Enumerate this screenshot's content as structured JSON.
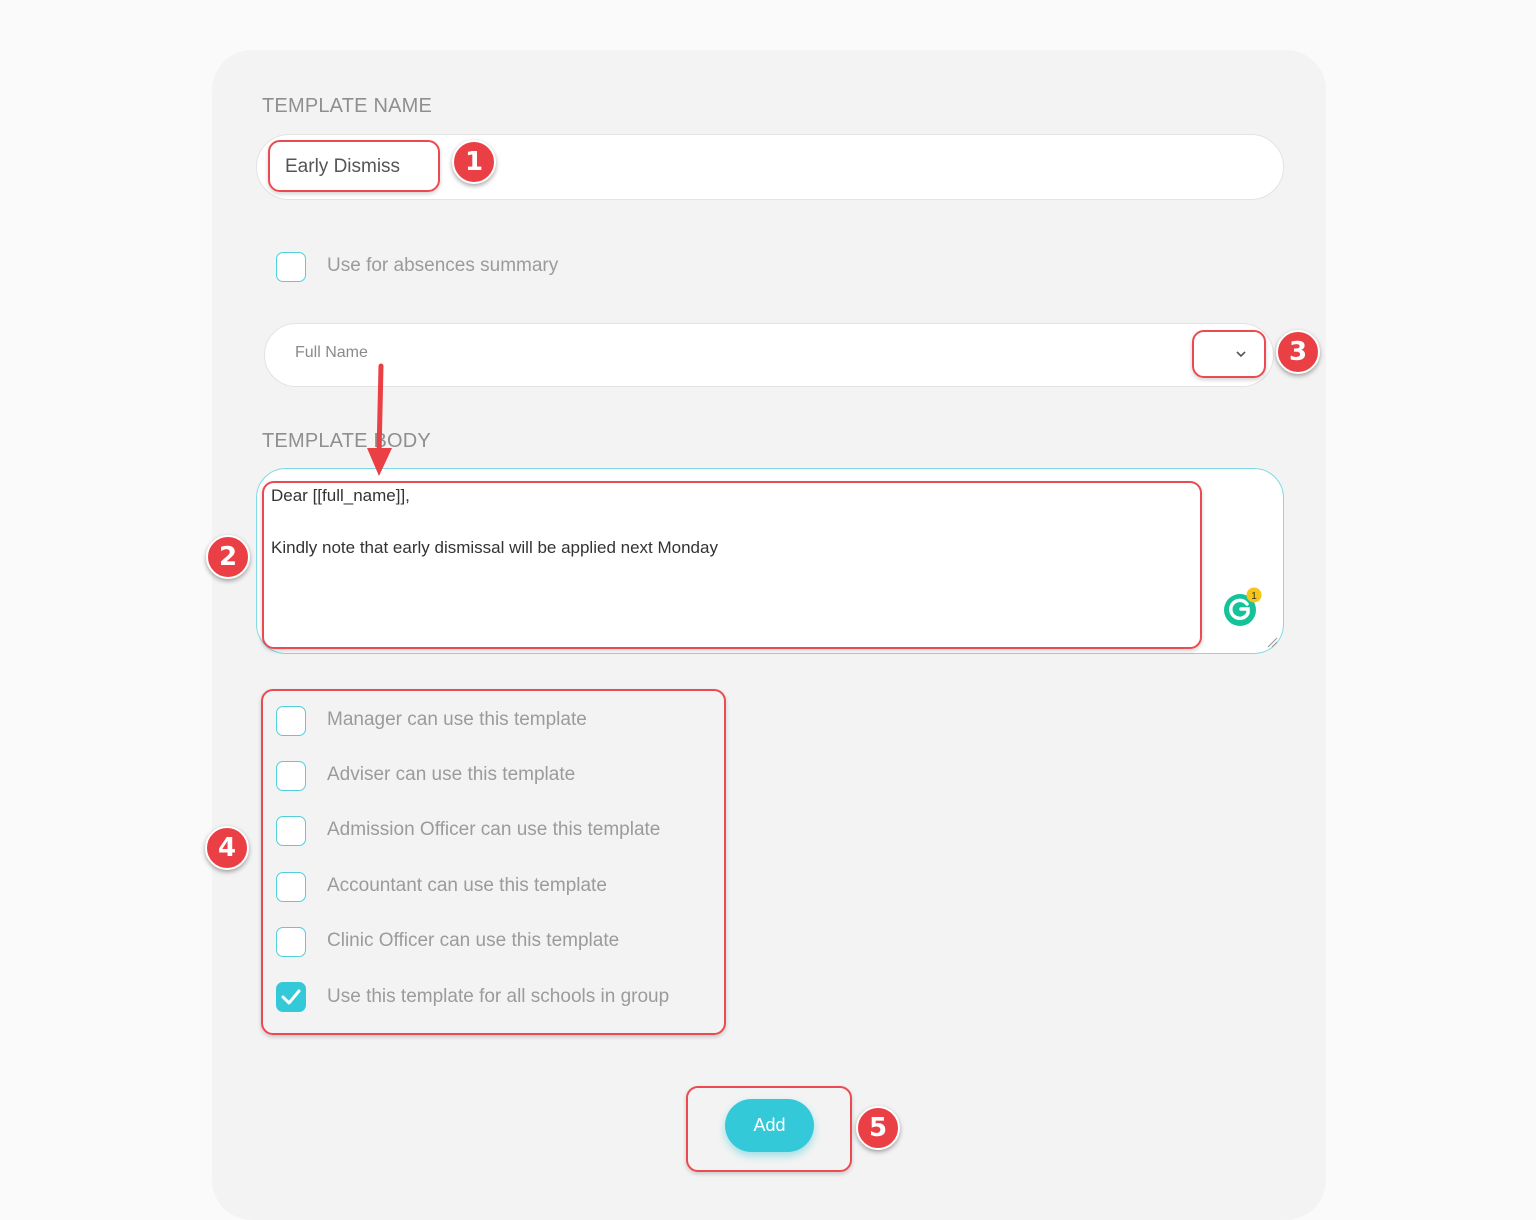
{
  "form": {
    "template_name_label": "TEMPLATE NAME",
    "template_name_value": "Early Dismiss",
    "absences_summary_label": "Use for absences summary",
    "absences_summary_checked": false,
    "placeholder_select_value": "Full Name",
    "template_body_label": "TEMPLATE BODY",
    "template_body_lines": [
      "Dear [[full_name]],",
      "Kindly note that early dismissal will be applied next Monday"
    ],
    "grammarly_count": "1",
    "permissions": [
      {
        "label": "Manager can use this template",
        "checked": false
      },
      {
        "label": "Adviser can use this template",
        "checked": false
      },
      {
        "label": "Admission Officer can use this template",
        "checked": false
      },
      {
        "label": "Accountant can use this template",
        "checked": false
      },
      {
        "label": "Clinic Officer can use this template",
        "checked": false
      },
      {
        "label": "Use this template for all schools in group",
        "checked": true
      }
    ],
    "add_button_label": "Add"
  },
  "annotations": {
    "badges": [
      "1",
      "2",
      "3",
      "4",
      "5"
    ]
  },
  "colors": {
    "accent": "#34c9d9",
    "annotation_red": "#ea3f45",
    "label_gray": "#9b9b9b"
  }
}
